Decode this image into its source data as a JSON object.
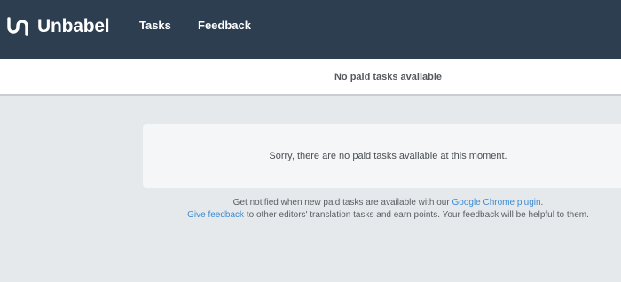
{
  "brand": {
    "name": "Unbabel",
    "logo_icon": "unbabel-u-mark",
    "colors": {
      "nav_bg": "#2c3e50",
      "link": "#3d8bd0",
      "page_bg": "#e6e9ec"
    }
  },
  "nav": {
    "tasks_label": "Tasks",
    "feedback_label": "Feedback"
  },
  "subbar": {
    "title": "No paid tasks available"
  },
  "notice": {
    "message": "Sorry, there are no paid tasks available at this moment."
  },
  "info": {
    "line1_prefix": "Get notified when new paid tasks are available with our ",
    "line1_link": "Google Chrome plugin",
    "line1_suffix": ".",
    "line2_link": "Give feedback",
    "line2_suffix": " to other editors' translation tasks and earn points. Your feedback will be helpful to them."
  }
}
